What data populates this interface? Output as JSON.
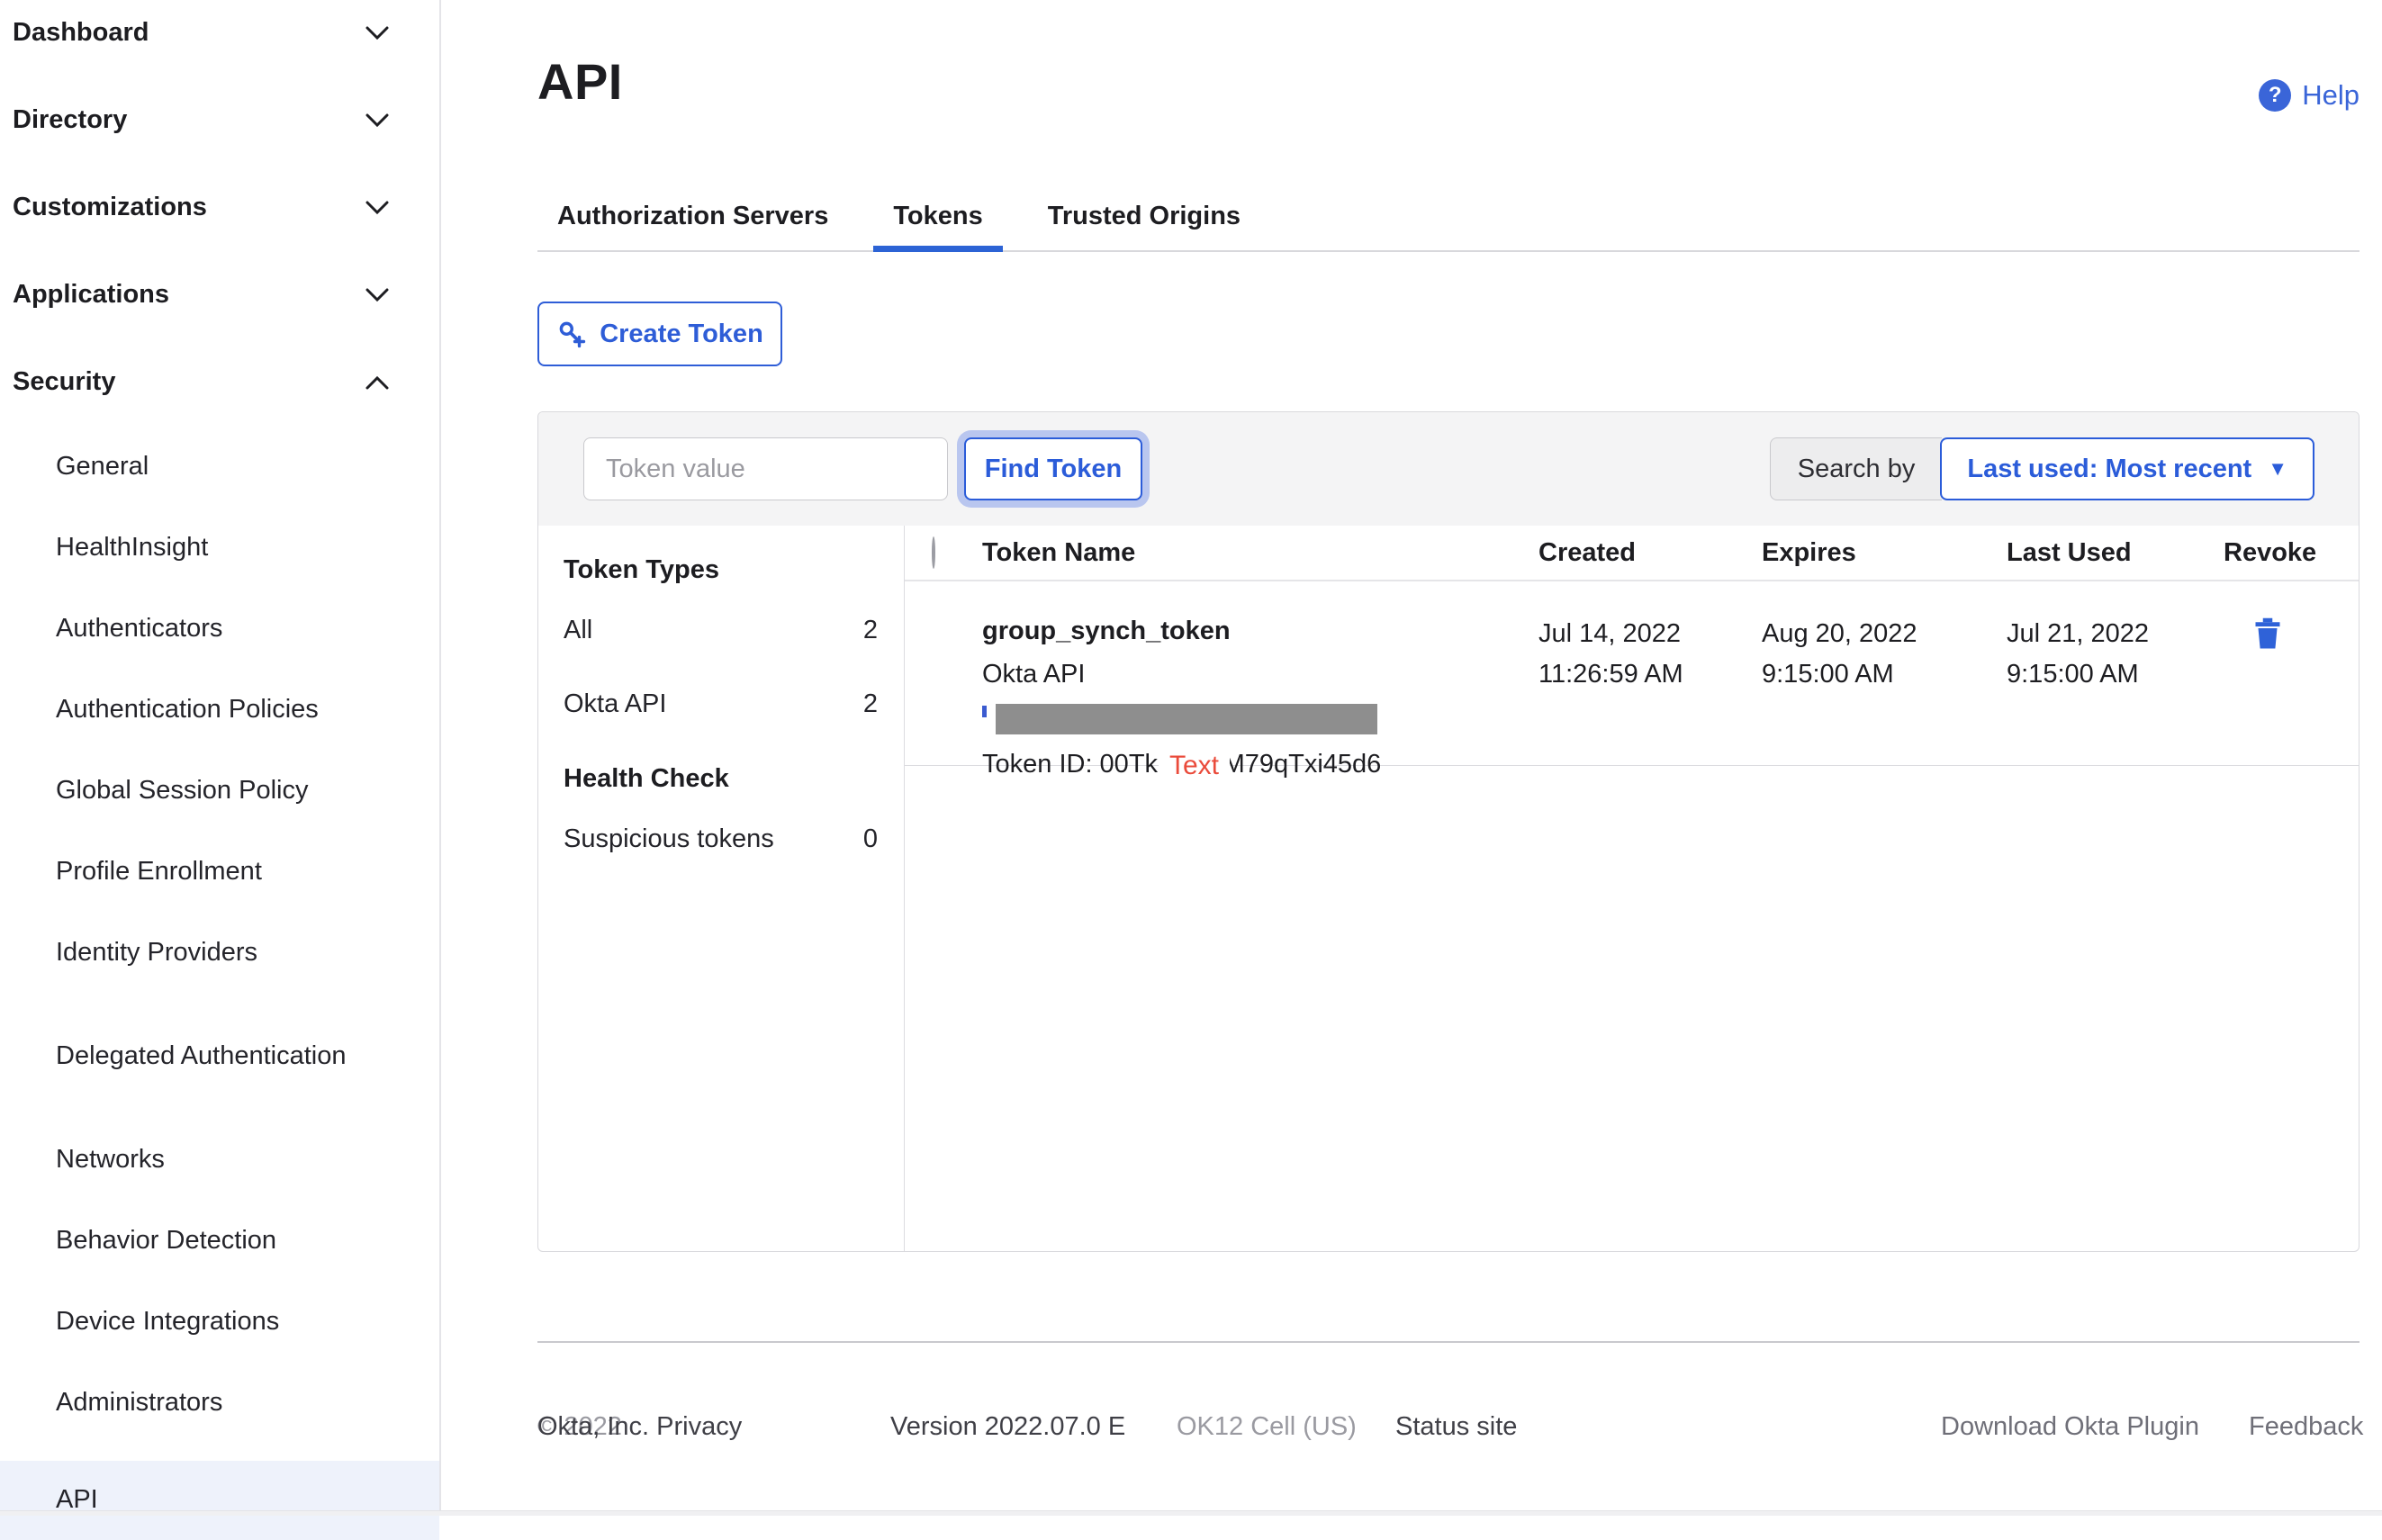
{
  "sidebar": {
    "top_items": [
      {
        "label": "Dashboard",
        "expanded": false
      },
      {
        "label": "Directory",
        "expanded": false
      },
      {
        "label": "Customizations",
        "expanded": false
      },
      {
        "label": "Applications",
        "expanded": false
      },
      {
        "label": "Security",
        "expanded": true
      }
    ],
    "sub_items": [
      "General",
      "HealthInsight",
      "Authenticators",
      "Authentication Policies",
      "Global Session Policy",
      "Profile Enrollment",
      "Identity Providers",
      "Delegated Authentication",
      "Networks",
      "Behavior Detection",
      "Device Integrations",
      "Administrators",
      "API"
    ],
    "active_item": "API"
  },
  "header": {
    "title": "API",
    "help_label": "Help",
    "help_icon": "?"
  },
  "tabs": [
    {
      "label": "Authorization Servers",
      "active": false
    },
    {
      "label": "Tokens",
      "active": true
    },
    {
      "label": "Trusted Origins",
      "active": false
    }
  ],
  "toolbar": {
    "create_token_label": "Create Token"
  },
  "search": {
    "placeholder": "Token value",
    "find_button": "Find Token",
    "search_by_label": "Search by",
    "sort_value": "Last used: Most recent",
    "caret": "▼"
  },
  "filters": {
    "token_types_title": "Token Types",
    "type_items": [
      {
        "label": "All",
        "count": "2"
      },
      {
        "label": "Okta API",
        "count": "2"
      }
    ],
    "health_title": "Health Check",
    "health_items": [
      {
        "label": "Suspicious tokens",
        "count": "0"
      }
    ]
  },
  "table": {
    "columns": [
      "Token Name",
      "Created",
      "Expires",
      "Last Used",
      "Revoke"
    ],
    "rows": [
      {
        "name": "group_synch_token",
        "type": "Okta API",
        "token_id": "Token ID: 00Tkaf7h4M79qTxi45d6",
        "created_date": "Jul 14, 2022",
        "created_time": "11:26:59 AM",
        "expires_date": "Aug 20, 2022",
        "expires_time": "9:15:00 AM",
        "last_used_date": "Jul 21, 2022",
        "last_used_time": "9:15:00 AM",
        "status": "active"
      }
    ]
  },
  "annotation": {
    "label": "Text"
  },
  "footer": {
    "copyright": "© 2022",
    "company": "Okta, Inc. Privacy",
    "version": "Version 2022.07.0 E",
    "cell": "OK12 Cell (US)",
    "status_site": "Status site",
    "download_plugin": "Download Okta Plugin",
    "feedback": "Feedback"
  },
  "colors": {
    "accent_blue": "#2b5cd9",
    "status_green": "#4aa570",
    "annotation_red": "#ea4b3b",
    "panel_gray": "#f4f4f5",
    "active_nav_bg": "#eef2fb"
  }
}
